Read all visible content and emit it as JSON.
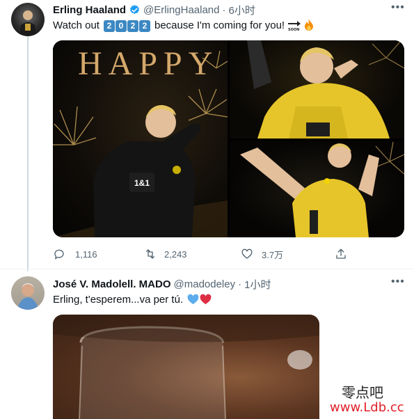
{
  "tweet1": {
    "display_name": "Erling Haaland",
    "handle": "@ErlingHaaland",
    "separator": "·",
    "time": "6小时",
    "more_icon": "more-dots-icon",
    "text_before": "Watch out",
    "keycaps": [
      "2",
      "0",
      "2",
      "2"
    ],
    "text_after": "because I'm coming for you!",
    "image_text": "HAPPY",
    "jersey_text": "1&1",
    "actions": {
      "replies": "1,116",
      "retweets": "2,243",
      "likes": "3.7万"
    },
    "colors": {
      "verified": "#1d9bf0",
      "keycap": "#3b88c3",
      "jersey": "#f4d400"
    }
  },
  "tweet2": {
    "display_name": "José V. Madolell. MADO",
    "handle": "@madodeley",
    "separator": "·",
    "time": "1小时",
    "text": "Erling, t'esperem...va per tú."
  },
  "watermark": {
    "line1": "零点吧",
    "line2": "www.Ldb.cc"
  }
}
